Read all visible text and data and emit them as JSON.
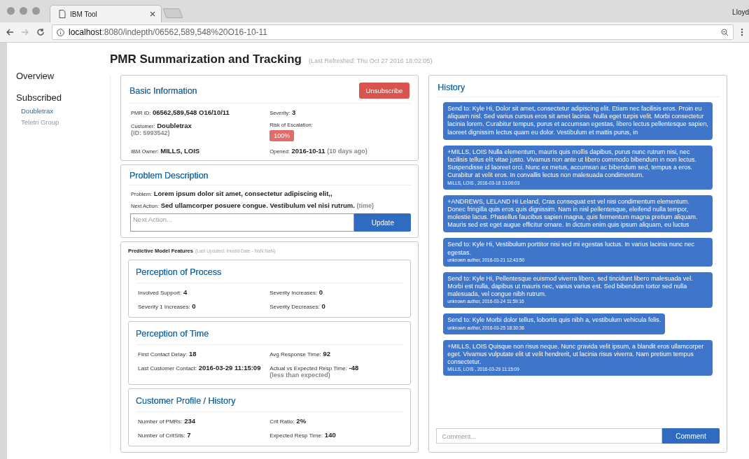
{
  "browser": {
    "tab_title": "IBM Tool",
    "url_host": "localhost",
    "url_path": ":8080/indepth/06562,589,548%20O16-10-11",
    "profile": "Lloyd"
  },
  "sidebar": {
    "items": [
      {
        "label": "Overview",
        "kind": "heading",
        "selected": false
      },
      {
        "label": "Subscribed",
        "kind": "heading",
        "selected": false
      },
      {
        "label": "Doubletrax",
        "kind": "sub",
        "selected": true
      },
      {
        "label": "Teletri Group",
        "kind": "sub",
        "selected": false
      }
    ]
  },
  "page": {
    "title": "PMR Summarization and Tracking",
    "refreshed": "(Last Refreshed: Thu Oct 27 2016 18:02:05)"
  },
  "basic_information": {
    "title": "Basic Information",
    "unsubscribe_button": "Unsubscribe",
    "pmr_id": {
      "label": "PMR ID:",
      "value": "06562,589,548 O16/10/11"
    },
    "severity": {
      "label": "Severity:",
      "value": "3"
    },
    "customer": {
      "label": "Customer:",
      "value": "Doubletrax",
      "note": "(ID: 5993542)"
    },
    "risk_of_escalation": {
      "label": "Risk of Escalation:",
      "value": "100%"
    },
    "ibm_owner": {
      "label": "IBM Owner:",
      "value": "MILLS, LOIS"
    },
    "opened": {
      "label": "Opened:",
      "value": "2016-10-11",
      "note": "(10 days ago)"
    }
  },
  "problem_description": {
    "title": "Problem Description",
    "problem": {
      "label": "Problem:",
      "value": "Lorem ipsum dolor sit amet, consectetur adipiscing elit,,"
    },
    "next_action": {
      "label": "Next Action:",
      "value": "Sed ullamcorper posuere congue. Vestibulum vel nisi rutrum.",
      "note": "(time)"
    },
    "input": {
      "placeholder": "Next Action..."
    },
    "update_button": "Update"
  },
  "predictive_model": {
    "title": "Predictive Model Features",
    "updated": "(Last Updated: Invalid Date - NaN:NaN)",
    "sections": [
      {
        "title": "Perception of Process",
        "fields": [
          {
            "label": "Involved Support:",
            "value": "4"
          },
          {
            "label": "Severity Increases:",
            "value": "0"
          },
          {
            "label": "Severity 1 Increases:",
            "value": "0"
          },
          {
            "label": "Severity Decreases:",
            "value": "0"
          }
        ]
      },
      {
        "title": "Perception of Time",
        "fields": [
          {
            "label": "First Contact Delay:",
            "value": "18"
          },
          {
            "label": "Avg Response Time:",
            "value": "92"
          },
          {
            "label": "Last Customer Contact:",
            "value": "2016-03-29 11:15:09"
          },
          {
            "label": "Actual vs Expected Resp Time:",
            "value": "-48",
            "note": "(less than expected)"
          }
        ]
      },
      {
        "title": "Customer Profile / History",
        "fields": [
          {
            "label": "Number of PMRs:",
            "value": "234"
          },
          {
            "label": "Crit Ratio:",
            "value": "2%"
          },
          {
            "label": "Number of CritSits:",
            "value": "7"
          },
          {
            "label": "Expected Resp Time:",
            "value": "140"
          }
        ]
      }
    ]
  },
  "history": {
    "title": "History",
    "messages": [
      {
        "text": "Send to: Kyle Hi, Dolor sit amet, consectetur adipiscing elit. Etiam nec facilisis eros. Proin eu aliquam nisl. Sed varius cursus eros sit amet lacinia. Nulla eget turpis velit. Morbi consectetur lacinia lorem. Curabitur tempus, purus et accumsan egestas, libero lectus pellentesque sapien, laoreet dignissim lectus quam eu dolor. Vestibulum et mattis purus, in"
      },
      {
        "text": "+MILLS, LOIS Nulla elementum, mauris quis mollis dapibus, purus nunc rutrum nisi, nec facilisis tellus elit vitae justo. Vivamus non ante ut libero commodo bibendum in non lectus. Suspendisse id laoreet orci. Nunc ex metus, accumsan ac bibendum sed, tempus a eros. Curabitur at velit eros. In convallis lectus non malesuada condimentum.",
        "meta": "MILLS, LOIS , 2016-03-18 13:00:03"
      },
      {
        "text": "+ANDREWS, LELAND Hi Leland, Cras consequat est vel nisi condimentum elementum. Donec fringilla quis eros quis dignissim. Nam in nisl pellentesque, eleifend nulla tempor, molestie lacus. Phasellus faucibus sapien magna, quis fermentum magna pretium aliquam. Mauris sed est eget augue efficitur ornare. In dictum enim quis ipsum aliquam, eu luctus"
      },
      {
        "text": "Send to: Kyle Hi, Vestibulum porttitor nisi sed mi egestas luctus. In varius lacinia nunc nec egestas.",
        "meta": "unknown author, 2016-03-21 12:43:50"
      },
      {
        "text": "Send to: Kyle Hi, Pellentesque euismod viverra libero, sed tincidunt libero malesuada vel. Morbi est nulla, dapibus ut mauris nec, varius varius est. Sed bibendum tortor sed nulla malesuada, vel congue nibh rutrum.",
        "meta": "unknown author, 2016-03-24 11:59:16"
      },
      {
        "text": "Send to: Kyle Morbi dolor tellus, lobortis quis nibh a, vestibulum vehicula felis.",
        "meta": "unknown author, 2016-03-25 18:30:36"
      },
      {
        "text": "+MILLS, LOIS Quisque non risus neque. Nunc gravida velit ipsum, a blandit eros ullamcorper eget. Vivamus vulputate elit ut velit hendrerit, ut lacinia risus viverra. Nam pretium tempus consectetur.",
        "meta": "MILLS, LOIS , 2016-03-29 11:15:09"
      }
    ],
    "comment_input": {
      "placeholder": "Comment..."
    },
    "comment_button": "Comment"
  }
}
